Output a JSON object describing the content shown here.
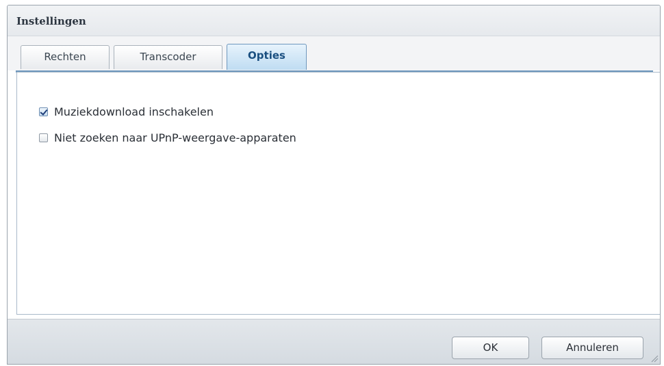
{
  "dialog": {
    "title": "Instellingen"
  },
  "tabs": [
    {
      "label": "Rechten",
      "active": false
    },
    {
      "label": "Transcoder",
      "active": false
    },
    {
      "label": "Opties",
      "active": true
    }
  ],
  "options": [
    {
      "label": "Muziekdownload inschakelen",
      "checked": true
    },
    {
      "label": "Niet zoeken naar UPnP-weergave-apparaten",
      "checked": false
    }
  ],
  "footer": {
    "ok_label": "OK",
    "cancel_label": "Annuleren"
  },
  "icons": {
    "resize": "resize-grip-icon",
    "checkbox_checked": "checkbox-checked-icon",
    "checkbox_unchecked": "checkbox-unchecked-icon"
  },
  "colors": {
    "active_tab": "#bfdcf2",
    "active_tab_text": "#1a4f80",
    "accent_border": "#6e97bd"
  }
}
